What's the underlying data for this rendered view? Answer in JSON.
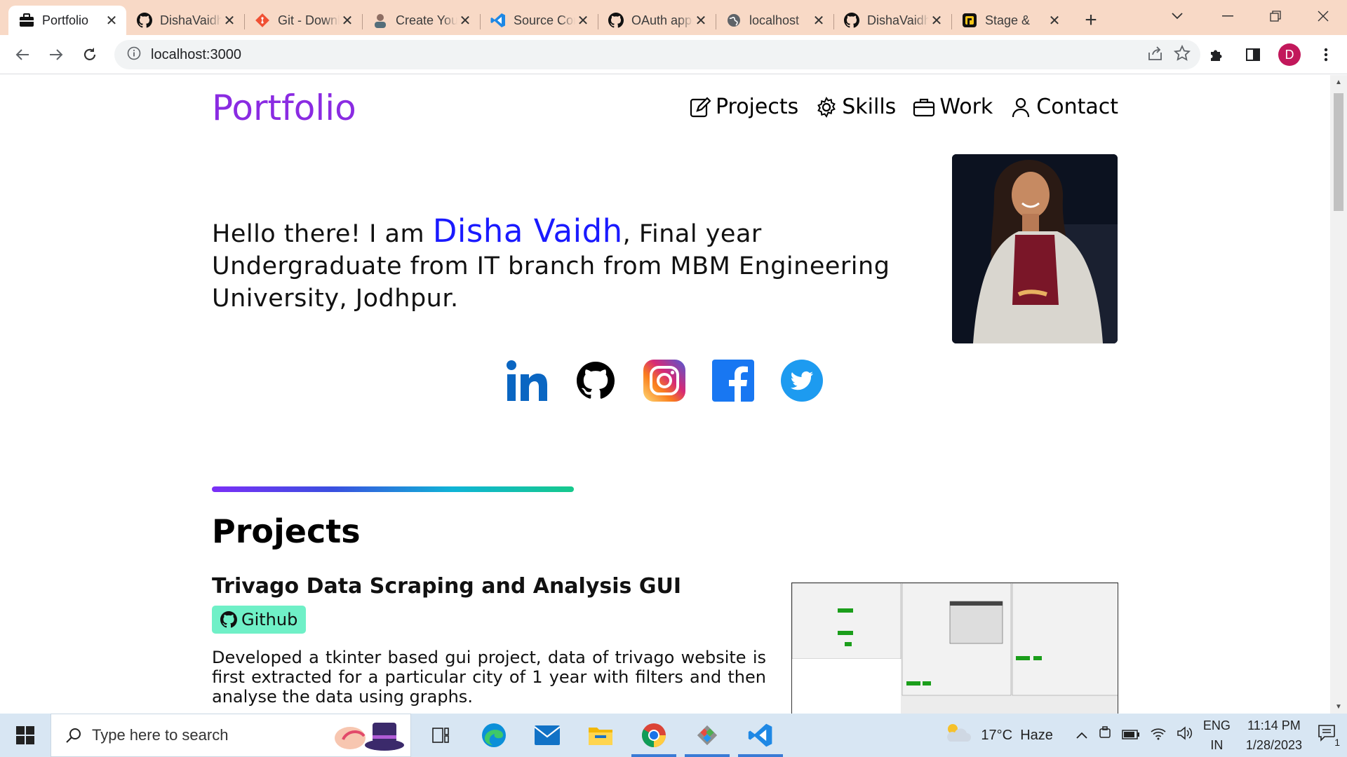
{
  "browser": {
    "tabs": [
      {
        "title": "Portfolio",
        "icon": "briefcase-icon",
        "active": true
      },
      {
        "title": "DishaVaidh",
        "icon": "github-icon"
      },
      {
        "title": "Git - Downloads",
        "icon": "git-icon"
      },
      {
        "title": "Create Your",
        "icon": "avatar-icon"
      },
      {
        "title": "Source Control",
        "icon": "vscode-icon"
      },
      {
        "title": "OAuth apps",
        "icon": "github-icon"
      },
      {
        "title": "localhost",
        "icon": "globe-icon"
      },
      {
        "title": "DishaVaidh",
        "icon": "github-icon"
      },
      {
        "title": "Stage &",
        "icon": "unstop-icon"
      }
    ],
    "url": "localhost:3000",
    "profile_initial": "D"
  },
  "site": {
    "brand": "Portfolio",
    "nav": [
      {
        "label": "Projects",
        "icon": "edit-icon"
      },
      {
        "label": "Skills",
        "icon": "gear-icon"
      },
      {
        "label": "Work",
        "icon": "briefcase-icon"
      },
      {
        "label": "Contact",
        "icon": "person-icon"
      }
    ],
    "hero": {
      "greeting": "Hello there! I am ",
      "name": "Disha Vaidh",
      "rest": ", Final year Undergraduate from IT branch from MBM Engineering University, Jodhpur."
    },
    "socials": [
      "linkedin-icon",
      "github-icon",
      "instagram-icon",
      "facebook-icon",
      "twitter-icon"
    ],
    "projects_section": {
      "title": "Projects",
      "items": [
        {
          "title": "Trivago Data Scraping and Analysis GUI",
          "button_label": "Github",
          "description": "Developed a tkinter based gui project, data of trivago website is first extracted for a particular city of 1 year with filters and then analyse the data using graphs."
        }
      ]
    }
  },
  "taskbar": {
    "search_placeholder": "Type here to search",
    "weather": "17°C  Haze",
    "lang_top": "ENG",
    "lang_bottom": "IN",
    "time": "11:14 PM",
    "date": "1/28/2023",
    "notifications": "1"
  }
}
